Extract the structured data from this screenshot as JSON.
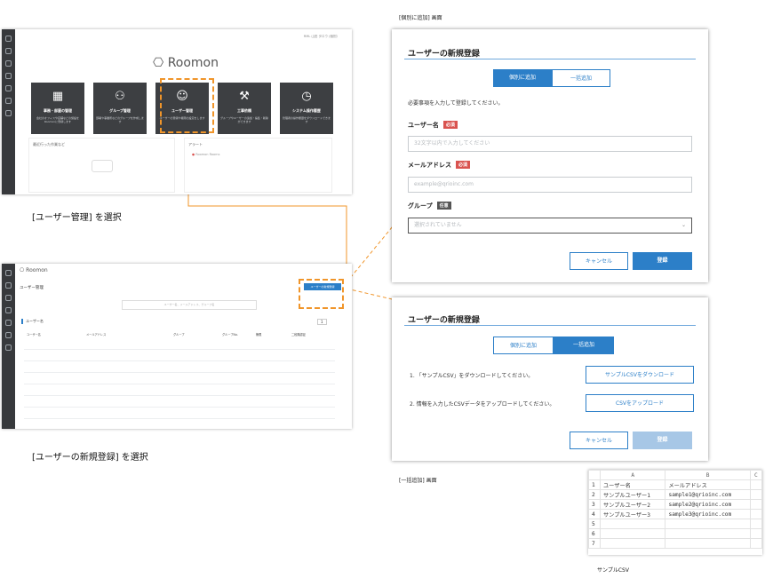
{
  "top_caption": "[個別に追加] 画面",
  "bulk_caption": "[一括追加] 画面",
  "sheet_caption": "サンプルCSV",
  "step1_caption": "[ユーザー管理] を選択",
  "step2_caption": "[ユーザーの新規登録] を選択",
  "home": {
    "logo": "Roomon",
    "user": "RML 山田 タロウ (個別）",
    "tiles": [
      {
        "title": "事務・部屋の管理",
        "desc": "会社のオフィスや店舗などの施設をRoomonに登録します"
      },
      {
        "title": "グループ管理",
        "desc": "部署や事業所などのグループを作成します"
      },
      {
        "title": "ユーザー管理",
        "desc": "ユーザーの登録や権限の設定をします"
      },
      {
        "title": "工事依頼",
        "desc": "グループやユーザーの追加・編集・削除ができます"
      },
      {
        "title": "システム操作履歴",
        "desc": "管理者の操作履歴をダウンロードできます"
      }
    ],
    "recent_label": "最近行った作業など",
    "alert_label": "アラート",
    "alert_item": "Roomon Rooms"
  },
  "users_page": {
    "logo": "Roomon",
    "title": "ユーザー管理",
    "new_button": "ユーザーの新規登録",
    "search_placeholder": "ユーザー名、メールアドレス、グループ名",
    "section_title": "ユーザー名",
    "pager": "1",
    "columns": [
      "ユーザー名",
      "メールアドレス",
      "グループ",
      "グループNo.",
      "権限",
      "二段階認証"
    ]
  },
  "modal_individual": {
    "title": "ユーザーの新規登録",
    "tab_individual": "個別に追加",
    "tab_bulk": "一括追加",
    "instruction": "必要事項を入力して登録してください。",
    "username_label": "ユーザー名",
    "required_badge": "必須",
    "username_placeholder": "32文字以内で入力してください",
    "email_label": "メールアドレス",
    "email_placeholder": "example@qrioinc.com",
    "group_label": "グループ",
    "optional_badge": "任意",
    "group_placeholder": "選択されていません",
    "cancel": "キャンセル",
    "register": "登録"
  },
  "modal_bulk": {
    "title": "ユーザーの新規登録",
    "tab_individual": "個別に追加",
    "tab_bulk": "一括追加",
    "step1": "1. 「サンプルCSV」をダウンロードしてください。",
    "step1_button": "サンプルCSVをダウンロード",
    "step2": "2. 情報を入力したCSVデータをアップロードしてください。",
    "step2_button": "CSVをアップロード",
    "cancel": "キャンセル",
    "register": "登録"
  },
  "csv": {
    "col_headers": [
      "A",
      "B",
      "C"
    ],
    "rows": [
      [
        "1",
        "ユーザー名",
        "メールアドレス",
        ""
      ],
      [
        "2",
        "サンプルユーザー1",
        "sample1@qrioinc.com",
        ""
      ],
      [
        "3",
        "サンプルユーザー2",
        "sample2@qrioinc.com",
        ""
      ],
      [
        "4",
        "サンプルユーザー3",
        "sample3@qrioinc.com",
        ""
      ],
      [
        "5",
        "",
        "",
        ""
      ],
      [
        "6",
        "",
        "",
        ""
      ],
      [
        "7",
        "",
        "",
        ""
      ]
    ]
  },
  "colors": {
    "accent": "#2c7fc8",
    "highlight": "#f0952a",
    "required": "#d9534f",
    "tile": "#3d3f42"
  }
}
